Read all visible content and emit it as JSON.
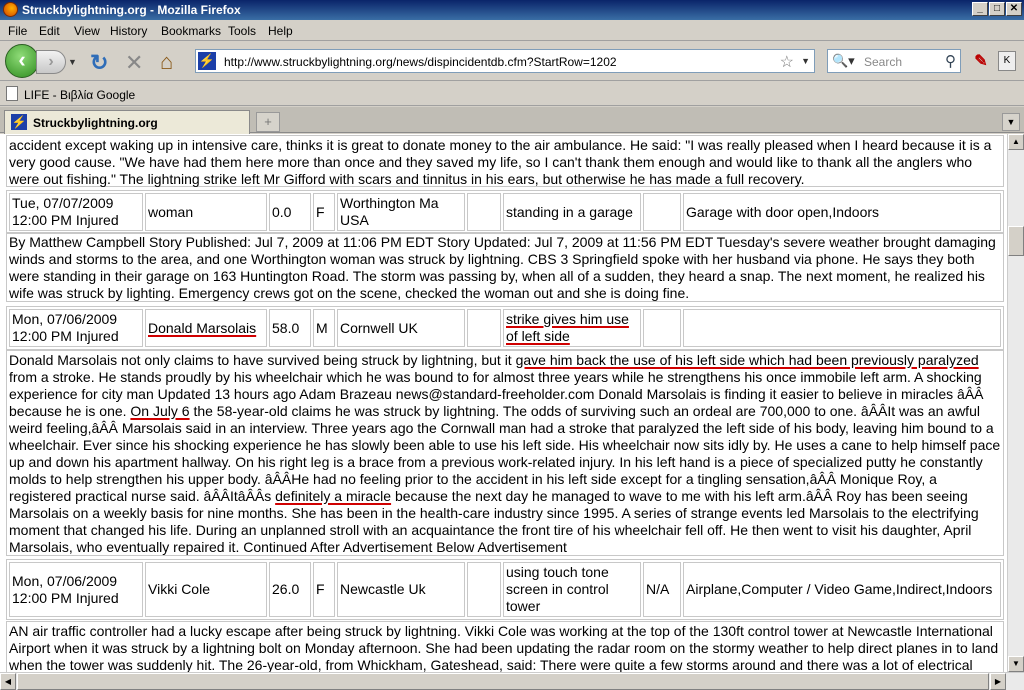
{
  "window": {
    "title": "Struckbylightning.org - Mozilla Firefox",
    "min": "_",
    "max": "□",
    "close": "✕"
  },
  "menu": [
    "File",
    "Edit",
    "View",
    "History",
    "Bookmarks",
    "Tools",
    "Help"
  ],
  "nav": {
    "url": "http://www.struckbylightning.org/news/dispincidentdb.cfm?StartRow=1202",
    "search_placeholder": "Search",
    "back_glyph": "‹",
    "forward_glyph": "›",
    "reload_glyph": "↻",
    "stop_glyph": "✕",
    "home_glyph": "⌂",
    "site_glyph": "⚡",
    "star_glyph": "☆",
    "search_glyph": "⚲"
  },
  "bookmarks": [
    {
      "label": "LIFE - Βιβλία Google"
    }
  ],
  "tabs": [
    {
      "label": "Struckbylightning.org"
    }
  ],
  "tab_new_glyph": "+",
  "entries": [
    {
      "story": "accident except waking up in intensive care, thinks it is great to donate money to the air ambulance. He said: \"I was really pleased when I heard because it is a very good cause. \"We have had them here more than once and they saved my life, so I can't thank them enough and would like to thank all the anglers who were out fishing.\" The lightning strike left Mr Gifford with scars and tinnitus in his ears, but otherwise he has made a full recovery."
    },
    {
      "date": "Tue, 07/07/2009",
      "time": "12:00 PM Injured",
      "name": "woman",
      "age": "0.0",
      "sex": "F",
      "location": "Worthington Ma USA",
      "blank": "",
      "activity": "standing in a garage",
      "misc": "",
      "category": "Garage with door open,Indoors",
      "story": "By Matthew Campbell Story Published: Jul 7, 2009 at 11:06 PM EDT Story Updated: Jul 7, 2009 at 11:56 PM EDT Tuesday's severe weather brought damaging winds and storms to the area, and one Worthington woman was struck by lightning. CBS 3 Springfield spoke with her husband via phone. He says they both were standing in their garage on 163 Huntington Road. The storm was passing by, when all of a sudden, they heard a snap. The next moment, he realized his wife was struck by lighting. Emergency crews got on the scene, checked the woman out and she is doing fine."
    },
    {
      "date": "Mon, 07/06/2009",
      "time": "12:00 PM Injured",
      "name": "Donald Marsolais",
      "age": "58.0",
      "sex": "M",
      "location": "Cornwell UK",
      "blank": "",
      "activity": "strike gives him use of left side",
      "misc": "",
      "category": "",
      "story_parts": [
        "Donald Marsolais not only claims to have survived being struck by lightning, but it ",
        "gave him back the use of his left side which had been previously paralyzed",
        " from a stroke. He stands proudly by his wheelchair which he was bound to for almost three years while he strengthens his once immobile left arm. A shocking experience for city man Updated 13 hours ago Adam Brazeau news@standard-freeholder.com Donald Marsolais is finding it easier to believe in miracles âÂÂ because he is one. ",
        "On July 6",
        " the 58-year-old claims he was struck by lightning. The odds of surviving such an ordeal are 700,000 to one. âÂÂIt was an awful weird feeling,âÂÂ Marsolais said in an interview. Three years ago the Cornwall man had a stroke that paralyzed the left side of his body, leaving him bound to a wheelchair. Ever since his shocking experience he has slowly been able to use his left side. His wheelchair now sits idly by. He uses a cane to help himself pace up and down his apartment hallway. On his right leg is a brace from a previous work-related injury. In his left hand is a piece of specialized putty he constantly molds to help strengthen his upper body. âÂÂHe had no feeling prior to the accident in his left side except for a tingling sensation,âÂÂ Monique Roy, a registered practical nurse said. âÂÂItâÂÂs ",
        "definitely a miracle",
        " because the next day he managed to wave to me with his left arm.âÂÂ Roy has been seeing Marsolais on a weekly basis for nine months. She has been in the health-care industry since 1995. A series of strange events led Marsolais to the electrifying moment that changed his life. During an unplanned stroll with an acquaintance the front tire of his wheelchair fell off. He then went to visit his daughter, April Marsolais, who eventually repaired it. Continued After Advertisement Below Advertisement"
      ]
    },
    {
      "date": "Mon, 07/06/2009",
      "time": "12:00 PM Injured",
      "name": "Vikki Cole",
      "age": "26.0",
      "sex": "F",
      "location": "Newcastle Uk",
      "blank": "",
      "activity": "using touch tone screen in control tower",
      "misc": "N/A",
      "category": "Airplane,Computer / Video Game,Indirect,Indoors",
      "story": "AN air traffic controller had a lucky escape after being struck by lightning. Vikki Cole was working at the top of the 130ft control tower at Newcastle International Airport when it was struck by a lightning bolt on Monday afternoon. She had been updating the radar room on the stormy weather to help direct planes in to land when the tower was suddenly hit. The 26-year-old, from Whickham, Gateshead, said: There were quite a few storms around and there was a lot of electrical"
    }
  ]
}
